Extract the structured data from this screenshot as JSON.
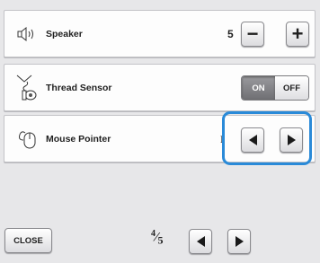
{
  "rows": {
    "speaker": {
      "icon": "speaker-icon",
      "label": "Speaker",
      "value": "5",
      "minus_label": "−",
      "plus_label": "+"
    },
    "thread_sensor": {
      "icon": "thread-sensor-icon",
      "label": "Thread Sensor",
      "on_label": "ON",
      "off_label": "OFF",
      "selected": "ON"
    },
    "mouse_pointer": {
      "icon": "mouse-icon",
      "label": "Mouse Pointer",
      "value": "I",
      "prev_icon": "triangle-left-icon",
      "next_icon": "triangle-right-icon",
      "highlighted": true
    }
  },
  "footer": {
    "close_label": "CLOSE",
    "page_current": "4",
    "page_total": "5",
    "prev_icon": "triangle-left-icon",
    "next_icon": "triangle-right-icon"
  },
  "colors": {
    "highlight": "#2a8ad8",
    "background": "#e7e7e9",
    "toggle_on": "#7a7a7e"
  }
}
